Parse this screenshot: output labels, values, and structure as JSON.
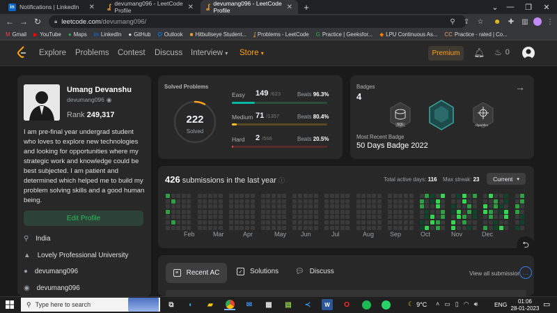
{
  "browser": {
    "tabs": [
      {
        "title": "Notifications | LinkedIn"
      },
      {
        "title": "devumang096 - LeetCode Profile"
      },
      {
        "title": "devumang096 - LeetCode Profile"
      }
    ],
    "url_host": "leetcode.com",
    "url_path": "/devumang096/",
    "bookmarks": [
      {
        "label": "Gmail",
        "icon": "M",
        "color": "#ea4335"
      },
      {
        "label": "YouTube",
        "icon": "▶",
        "color": "#ff0000"
      },
      {
        "label": "Maps",
        "icon": "●",
        "color": "#34a853"
      },
      {
        "label": "LinkedIn",
        "icon": "in",
        "color": "#0a66c2"
      },
      {
        "label": "GitHub",
        "icon": "●",
        "color": "#ffffff"
      },
      {
        "label": "Outlook",
        "icon": "O",
        "color": "#0078d4"
      },
      {
        "label": "Hitbullseye Student...",
        "icon": "■",
        "color": "#f0a030"
      },
      {
        "label": "Problems - LeetCode",
        "icon": "ʆ",
        "color": "#f0a030"
      },
      {
        "label": "Practice | Geeksfor...",
        "icon": "G",
        "color": "#2f8d46"
      },
      {
        "label": "LPU Continuous As...",
        "icon": "◆",
        "color": "#f57c00"
      },
      {
        "label": "Practice - rated | Co...",
        "icon": "CC",
        "color": "#b08050"
      }
    ]
  },
  "nav": {
    "items": [
      "Explore",
      "Problems",
      "Contest",
      "Discuss",
      "Interview",
      "Store"
    ],
    "premium": "Premium",
    "streak_count": "0"
  },
  "profile": {
    "name": "Umang Devanshu",
    "username": "devumang096",
    "rank_label": "Rank",
    "rank_value": "249,317",
    "bio": "I am pre-final year undergrad student who loves to explore new technologies and looking for opportunities where my strategic work and knowledge could be best subjected. I am patient and determined which helped me to build my problem solving skills and a good human being.",
    "edit_button": "Edit Profile",
    "location": "India",
    "university": "Lovely Professional University",
    "github": "devumang096",
    "twitter": "devumang096"
  },
  "solved": {
    "title": "Solved Problems",
    "total": "222",
    "total_label": "Solved",
    "progress_fraction": 0.08,
    "easy": {
      "label": "Easy",
      "count": "149",
      "of": "/623",
      "beats_label": "Beats",
      "beats": "96.3%",
      "fraction": 0.239
    },
    "medium": {
      "label": "Medium",
      "count": "71",
      "of": "/1357",
      "beats_label": "Beats",
      "beats": "80.4%",
      "fraction": 0.052
    },
    "hard": {
      "label": "Hard",
      "count": "2",
      "of": "/568",
      "beats_label": "Beats",
      "beats": "20.5%",
      "fraction": 0.004
    }
  },
  "badges": {
    "title": "Badges",
    "count": "4",
    "badge_labels": [
      "SQL",
      "Algorithm"
    ],
    "recent_label": "Most Recent Badge",
    "recent_name": "50 Days Badge 2022"
  },
  "submissions": {
    "count": "426",
    "title_rest": "submissions in the last year",
    "active_days_label": "Total active days:",
    "active_days": "116",
    "max_streak_label": "Max streak:",
    "max_streak": "23",
    "select_value": "Current",
    "months": [
      "Feb",
      "Mar",
      "Apr",
      "May",
      "Jun",
      "Jul",
      "Aug",
      "Sep",
      "Oct",
      "Nov",
      "Dec"
    ]
  },
  "tabs_bottom": {
    "recent_ac": "Recent AC",
    "solutions": "Solutions",
    "discuss": "Discuss",
    "view_all": "View all submissions"
  },
  "taskbar": {
    "search_placeholder": "Type here to search",
    "temperature": "9°C",
    "language": "ENG",
    "time": "01:06",
    "date": "28-01-2023"
  }
}
